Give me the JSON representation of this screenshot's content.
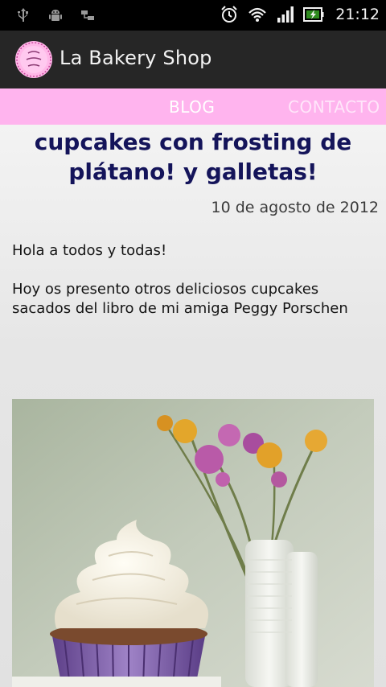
{
  "status_bar": {
    "icons_left": [
      "usb-icon",
      "android-debug-icon",
      "sync-icon"
    ],
    "icons_right": [
      "alarm-icon",
      "wifi-icon",
      "signal-icon",
      "battery-icon"
    ],
    "time": "21:12"
  },
  "app_bar": {
    "logo_icon": "bakery-logo-icon",
    "title": "La Bakery Shop"
  },
  "nav": {
    "tabs": [
      {
        "label": "BLOG"
      },
      {
        "label": "CONTACTO"
      }
    ],
    "colors": {
      "background": "#ffb4ee",
      "active": "#ffffff"
    }
  },
  "post": {
    "title": "cupcakes con frosting de plátano! y galletas!",
    "date": "10 de agosto de 2012",
    "paragraphs": [
      "Hola a todos y todas!",
      "Hoy os presento otros deliciosos cupcakes sacados del libro de mi amiga Peggy Porschen"
    ],
    "image_icon": "cupcake-photo"
  },
  "colors": {
    "title": "#14145a",
    "app_bar": "#262626",
    "status_bar": "#000000"
  }
}
